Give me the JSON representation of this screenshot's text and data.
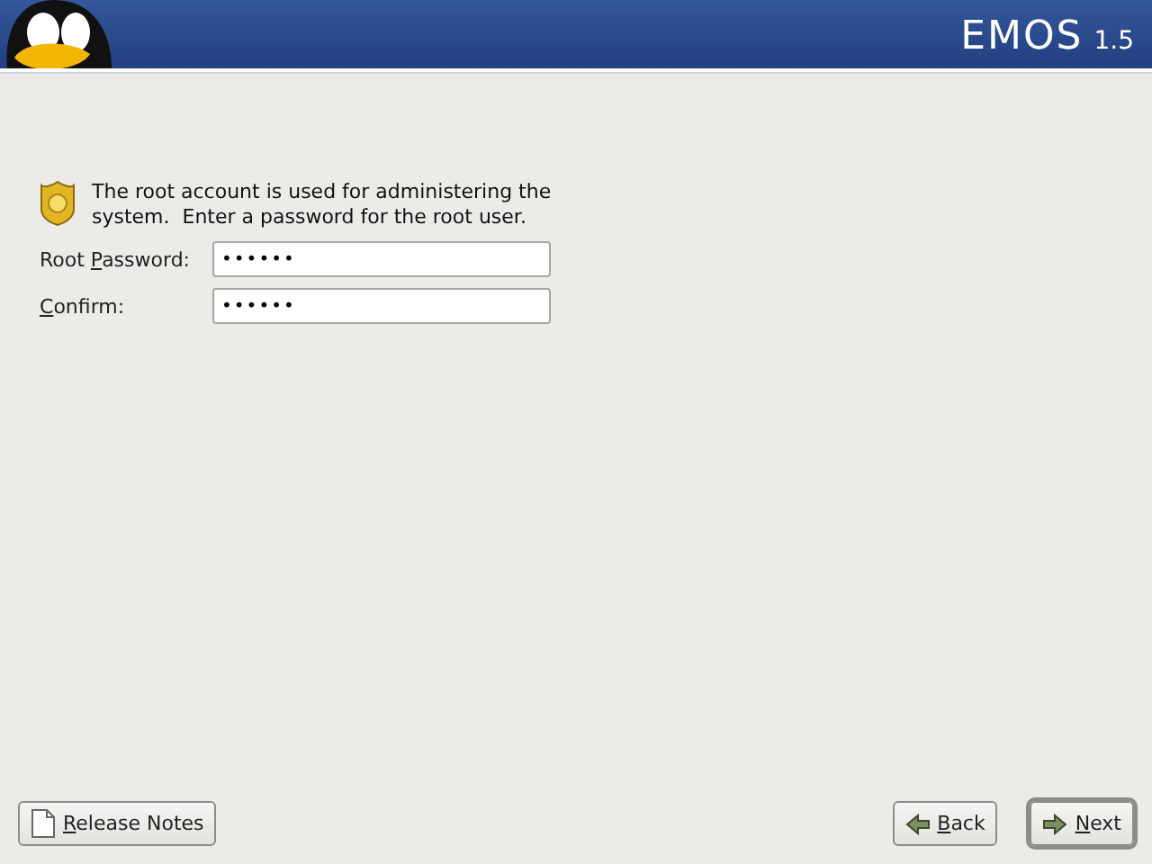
{
  "header": {
    "product": "EMOS",
    "version": "1.5"
  },
  "intro": "The root account is used for administering the system.  Enter a password for the root user.",
  "fields": [
    {
      "label": {
        "before": "Root ",
        "key": "P",
        "after": "assword:"
      },
      "value": "••••••"
    },
    {
      "label": {
        "key": "C",
        "after": "onfirm:"
      },
      "value": "••••••"
    }
  ],
  "buttons": {
    "release_notes": {
      "key": "R",
      "after": "elease Notes"
    },
    "back": {
      "key": "B",
      "after": "ack"
    },
    "next": {
      "key": "N",
      "after": "ext"
    }
  }
}
